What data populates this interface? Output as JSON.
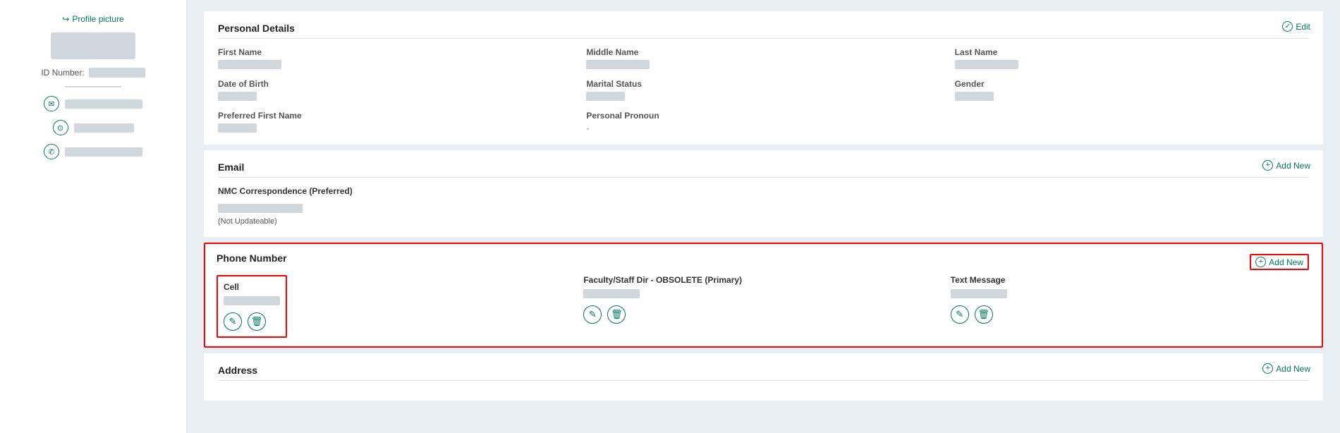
{
  "sidebar": {
    "profile_picture_label": "Profile picture",
    "id_label": "ID Number:",
    "id_value": "",
    "email_icon": "✉",
    "location_icon": "◎",
    "phone_icon": "✆"
  },
  "personal_details": {
    "section_title": "Personal Details",
    "edit_label": "Edit",
    "fields": {
      "first_name_label": "First Name",
      "middle_name_label": "Middle Name",
      "last_name_label": "Last Name",
      "dob_label": "Date of Birth",
      "marital_label": "Marital Status",
      "gender_label": "Gender",
      "preferred_first_label": "Preferred First Name",
      "pronoun_label": "Personal Pronoun",
      "pronoun_value": "-"
    }
  },
  "email": {
    "section_title": "Email",
    "add_new_label": "Add New",
    "email_type": "NMC Correspondence (Preferred)",
    "not_updateable": "(Not Updateable)"
  },
  "phone_number": {
    "section_title": "Phone Number",
    "add_new_label": "Add New",
    "cell_label": "Cell",
    "faculty_label": "Faculty/Staff Dir - OBSOLETE (Primary)",
    "text_label": "Text Message",
    "edit_icon": "✎",
    "delete_icon": "🗑"
  },
  "address": {
    "section_title": "Address",
    "add_new_label": "Add New"
  },
  "icons": {
    "edit": "✎",
    "plus": "+",
    "pencil": "✏",
    "trash": "🗑",
    "envelope": "✉",
    "location": "⊙",
    "phone": "✆",
    "check": "✓"
  }
}
